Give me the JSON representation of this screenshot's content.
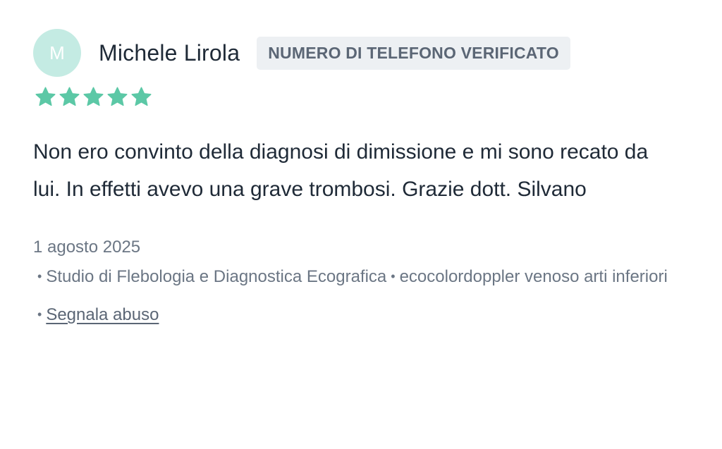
{
  "review": {
    "author": {
      "avatar_initial": "M",
      "name": "Michele Lirola",
      "badge": "NUMERO DI TELEFONO VERIFICATO"
    },
    "rating": {
      "value": 5,
      "max": 5,
      "icon": "star-icon",
      "color": "#5cc8a6"
    },
    "text": "Non ero convinto della diagnosi di dimissione e mi sono recato da lui. In effetti avevo una grave trombosi. Grazie dott. Silvano",
    "date": "1 agosto 2025",
    "facility": "Studio di Flebologia e Diagnostica Ecografica",
    "service": "ecocolordoppler venoso arti inferiori",
    "bullet": "•",
    "report_label": "Segnala abuso"
  },
  "colors": {
    "avatar_bg": "#c4ebe3",
    "badge_bg": "#edf0f3",
    "text": "#1f2a37",
    "muted": "#6b7684"
  }
}
